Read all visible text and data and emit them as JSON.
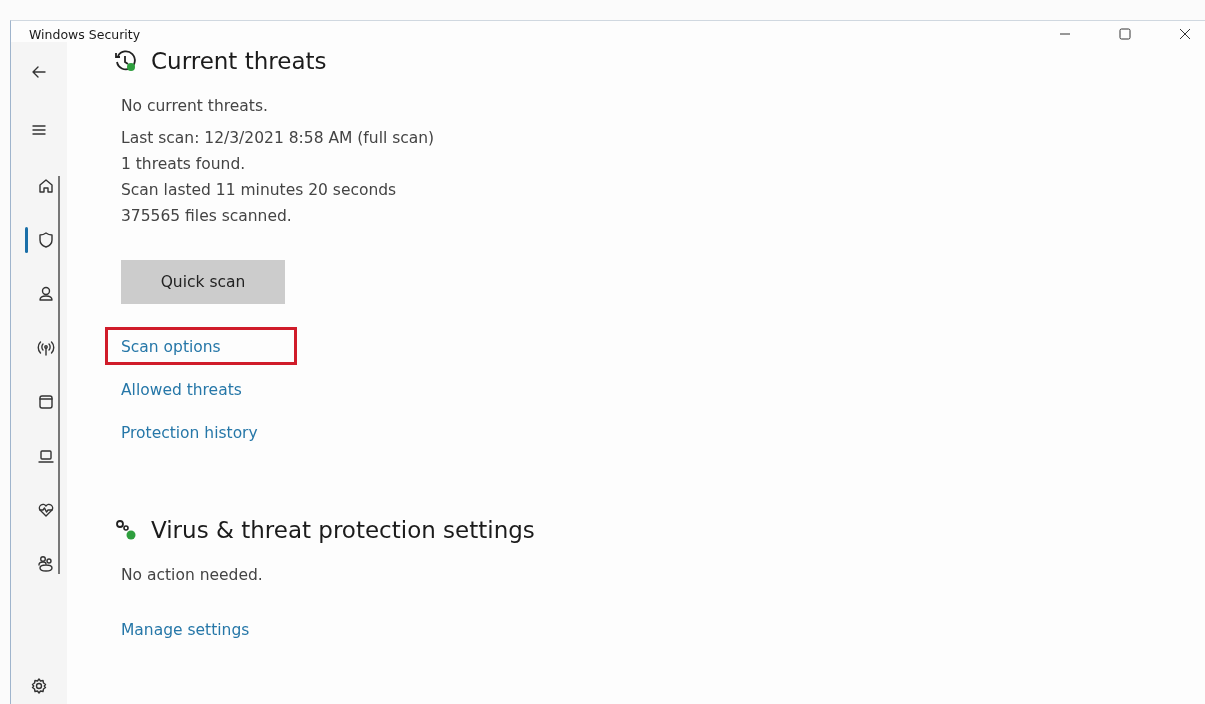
{
  "window": {
    "title": "Windows Security"
  },
  "sidebar": {
    "nav_items": [
      {
        "selected": false
      },
      {
        "selected": true
      },
      {
        "selected": false
      },
      {
        "selected": false
      },
      {
        "selected": false
      },
      {
        "selected": false
      },
      {
        "selected": false
      },
      {
        "selected": false
      }
    ]
  },
  "sections": [
    {
      "title": "Current threats",
      "lines": [
        "No current threats.",
        "Last scan: 12/3/2021 8:58 AM (full scan)",
        "1 threats found.",
        "Scan lasted 11 minutes 20 seconds",
        "375565 files scanned."
      ],
      "button": "Quick scan",
      "links": [
        {
          "label": "Scan options",
          "highlighted": true
        },
        {
          "label": "Allowed threats",
          "highlighted": false
        },
        {
          "label": "Protection history",
          "highlighted": false
        }
      ]
    },
    {
      "title": "Virus & threat protection settings",
      "lines": [
        "No action needed."
      ],
      "links": [
        {
          "label": "Manage settings",
          "highlighted": false
        }
      ]
    }
  ]
}
